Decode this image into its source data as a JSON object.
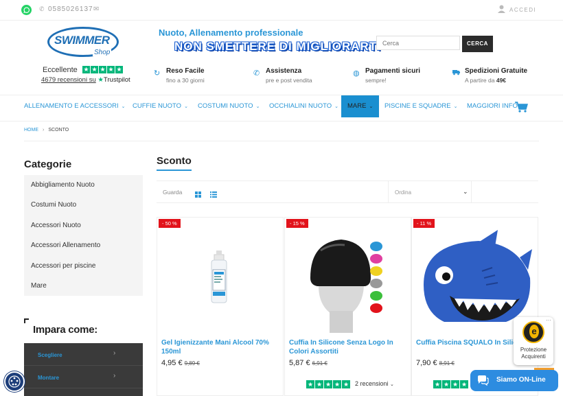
{
  "topbar": {
    "whatsapp_icon": "whatsapp-icon",
    "phone": "0585026137",
    "login_label": "ACCEDI"
  },
  "header": {
    "logo_text": "SWIMMER",
    "logo_sub": "Shop",
    "tagline_primary": "Nuoto, Allenamento professionale",
    "tagline_secondary": "NON SMETTERE DI MIGLIORARTI",
    "search_placeholder": "Cerca",
    "search_button": "CERCA",
    "rating_label": "Eccellente",
    "reviews_text": "4679 recensioni su",
    "trustpilot": "Trustpilot",
    "rating_stars": 5
  },
  "features": [
    {
      "title": "Reso Facile",
      "subtitle": "fino a 30 giorni",
      "icon": "refresh-icon"
    },
    {
      "title": "Assistenza",
      "subtitle": "pre e post vendita",
      "icon": "phone-icon"
    },
    {
      "title": "Pagamenti sicuri",
      "subtitle": "sempre!",
      "icon": "shield-icon"
    },
    {
      "title": "Spedizioni Gratuite",
      "subtitle_prefix": "A partire da ",
      "subtitle_bold": "49€",
      "icon": "truck-icon"
    }
  ],
  "nav": {
    "items": [
      "ALLENAMENTO E ACCESSORI",
      "CUFFIE NUOTO",
      "COSTUMI NUOTO",
      "OCCHIALINI NUOTO",
      "MARE",
      "PISCINE E SQUADRE",
      "MAGGIORI INFO"
    ],
    "active": "MARE",
    "colors": {
      "link": "#2a96d6",
      "active_bg": "#1a8fd0"
    }
  },
  "breadcrumb": {
    "home": "HOME",
    "current": "SCONTO"
  },
  "sidebar": {
    "title": "Categorie",
    "categories": [
      "Abbigliamento Nuoto",
      "Costumi Nuoto",
      "Accessori Nuoto",
      "Accessori Allenamento",
      "Accessori per piscine",
      "Mare"
    ],
    "learn_title": "Impara come:",
    "learn_items": [
      "Scegliere",
      "Montare"
    ]
  },
  "main": {
    "title": "Sconto",
    "view_label": "Guarda",
    "sort_label": "Ordina"
  },
  "products": [
    {
      "badge": "- 50 %",
      "name": "Gel Igienizzante Mani Alcool 70% 150ml",
      "price": "4,95 €",
      "old_price": "9,89 €"
    },
    {
      "badge": "- 15 %",
      "name": "Cuffia In Silicone Senza Logo In Colori Assortiti",
      "price": "5,87 €",
      "old_price": "6,91 €",
      "reviews": "2 recensioni"
    },
    {
      "badge": "- 11 %",
      "name": "Cuffia Piscina SQUALO In Silicone",
      "price": "7,90 €",
      "old_price": "8,91 €"
    }
  ],
  "widgets": {
    "trusted_label": "Protezione Acquirenti",
    "chat_label": "Siamo ON-Line"
  },
  "colors": {
    "brand_blue": "#2a96d6",
    "sale_red": "#e2131b",
    "trustpilot_green": "#00b67a",
    "chat_blue": "#2d8ce0"
  }
}
